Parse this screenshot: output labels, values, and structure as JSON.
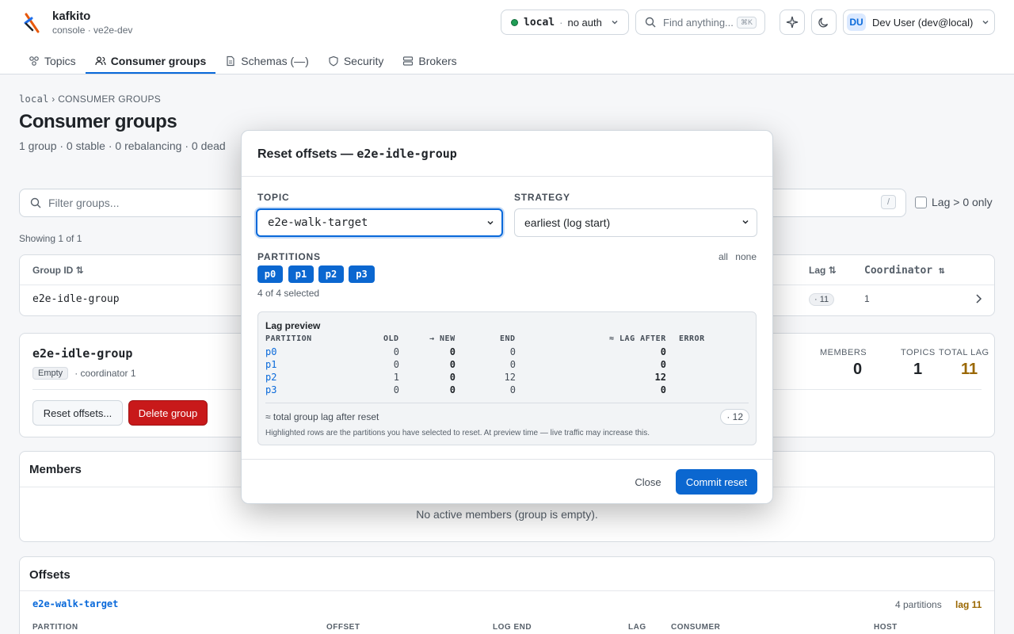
{
  "app": {
    "name": "kafkito",
    "subtitle": "console · ve2e-dev"
  },
  "env": {
    "name": "local",
    "sep": "·",
    "auth": "no auth",
    "status_color": "#1f9d55"
  },
  "search": {
    "placeholder": "Find anything...",
    "shortcut": "⌘K"
  },
  "user": {
    "initials": "DU",
    "name": "Dev User (dev@local)"
  },
  "nav": [
    {
      "label": "Topics",
      "icon": "topics-icon"
    },
    {
      "label": "Consumer groups",
      "icon": "users-icon",
      "active": true
    },
    {
      "label": "Schemas (—)",
      "icon": "file-icon"
    },
    {
      "label": "Security",
      "icon": "shield-icon"
    },
    {
      "label": "Brokers",
      "icon": "server-icon"
    }
  ],
  "breadcrumb": {
    "root": "local",
    "sep": "›",
    "current": "CONSUMER GROUPS"
  },
  "page": {
    "title": "Consumer groups",
    "summary": "1 group · 0 stable · 0 rebalancing · 0 dead"
  },
  "filter": {
    "placeholder": "Filter groups...",
    "shortcut": "/",
    "lag_only_label": "Lag > 0 only"
  },
  "showing": "Showing 1 of 1",
  "groups_table": {
    "columns": {
      "group_id": "Group ID",
      "lag": "Lag",
      "coordinator": "Coordinator"
    },
    "sort_glyph": "⇅",
    "rows": [
      {
        "group_id": "e2e-idle-group",
        "lag": "· 11",
        "coordinator": "1"
      }
    ]
  },
  "group_detail": {
    "name": "e2e-idle-group",
    "state": "Empty",
    "coordinator": "· coordinator 1",
    "stats": [
      {
        "label": "MEMBERS",
        "value": "0"
      },
      {
        "label": "TOPICS",
        "value": "1"
      },
      {
        "label": "TOTAL LAG",
        "value": "11"
      }
    ],
    "reset_label": "Reset offsets...",
    "delete_label": "Delete group",
    "lag_color": "#9a6700"
  },
  "members": {
    "title": "Members",
    "empty": "No active members (group is empty)."
  },
  "offsets": {
    "title": "Offsets",
    "topic": "e2e-walk-target",
    "partitions_count": "4 partitions",
    "lag": "lag 11",
    "columns": [
      "PARTITION",
      "OFFSET",
      "LOG END",
      "LAG",
      "CONSUMER",
      "HOST"
    ]
  },
  "modal": {
    "title_prefix": "Reset offsets — ",
    "group": "e2e-idle-group",
    "topic_label": "TOPIC",
    "topic_value": "e2e-walk-target",
    "strategy_label": "STRATEGY",
    "strategy_value": "earliest (log start)",
    "partitions_label": "PARTITIONS",
    "all_label": "all",
    "none_label": "none",
    "partitions": [
      "p0",
      "p1",
      "p2",
      "p3"
    ],
    "selected_count": "4 of 4 selected",
    "preview": {
      "title": "Lag preview",
      "columns": {
        "partition": "PARTITION",
        "old": "OLD",
        "new": "→ NEW",
        "end": "END",
        "lag_after": "≈ LAG AFTER",
        "error": "ERROR"
      },
      "rows": [
        {
          "partition": "p0",
          "old": "0",
          "new": "0",
          "end": "0",
          "lag_after": "0"
        },
        {
          "partition": "p1",
          "old": "0",
          "new": "0",
          "end": "0",
          "lag_after": "0"
        },
        {
          "partition": "p2",
          "old": "1",
          "new": "0",
          "end": "12",
          "lag_after": "12"
        },
        {
          "partition": "p3",
          "old": "0",
          "new": "0",
          "end": "0",
          "lag_after": "0"
        }
      ],
      "total_label": "≈ total group lag after reset",
      "total_value": "· 12",
      "note": "Highlighted rows are the partitions you have selected to reset. At preview time — live traffic may increase this."
    },
    "close_label": "Close",
    "commit_label": "Commit reset"
  },
  "colors": {
    "accent": "#0969da",
    "primary_button": "#0b67d0",
    "danger": "#c8191a"
  }
}
